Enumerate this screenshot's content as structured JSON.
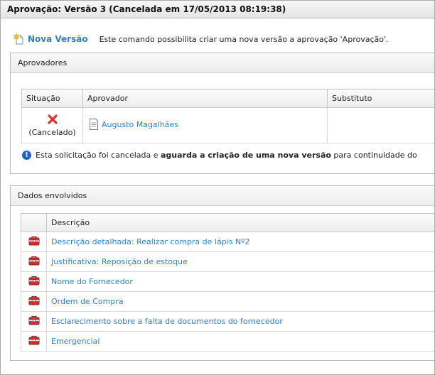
{
  "page_title": "Aprovação: Versão 3 (Cancelada em 17/05/2013 08:19:38)",
  "command": {
    "label": "Nova Versão",
    "description": "Este comando possibilita criar uma nova versão a aprovação 'Aprovação'.",
    "icon": "new-document-star-icon"
  },
  "approvers_panel": {
    "title": "Aprovadores",
    "columns": [
      "Situação",
      "Aprovador",
      "Substituto"
    ],
    "rows": [
      {
        "status_icon": "red-x-icon",
        "status": "(Cancelado)",
        "approver": "Augusto Magalhães",
        "substitute": ""
      }
    ],
    "info": {
      "prefix": "Esta solicitação foi cancelada e ",
      "bold": "aguarda a criação de uma nova versão",
      "suffix": " para continuidade do"
    }
  },
  "data_panel": {
    "title": "Dados envolvidos",
    "column": "Descrição",
    "items": [
      "Descrição detalhada: Realizar compra de lápis Nº2",
      "Justificativa: Reposição de estoque",
      "Nome do Fornecedor",
      "Ordem de Compra",
      "Esclarecimento sobre a falta de documentos do fornecedor",
      "Emergencial"
    ]
  },
  "colors": {
    "link": "#2f7fc2",
    "cancel_red": "#d8342a",
    "info_blue": "#1f63c8",
    "toolbox_red": "#c9302c"
  }
}
